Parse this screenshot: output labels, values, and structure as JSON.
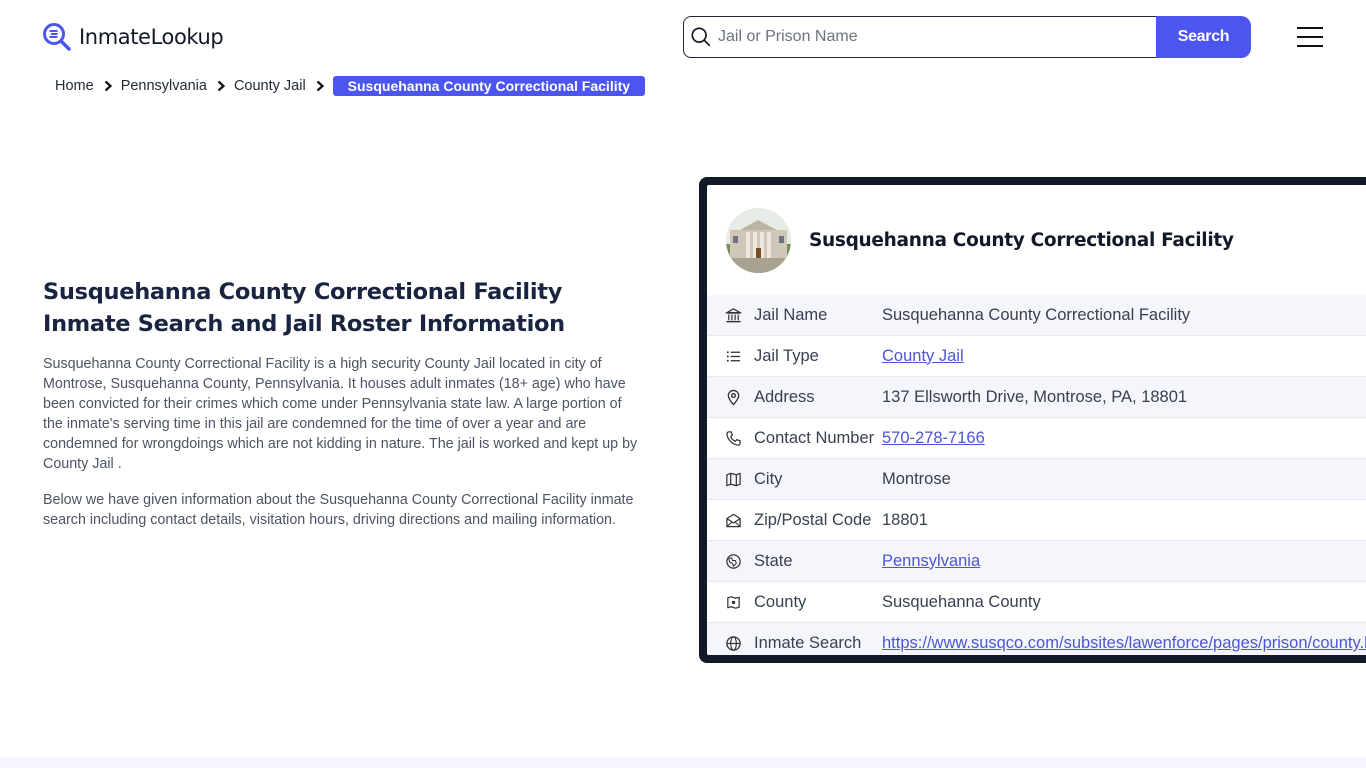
{
  "header": {
    "logo_text": "InmateLookup",
    "search_placeholder": "Jail or Prison Name",
    "search_value": "",
    "search_button": "Search",
    "brand_color": "#4c55f0"
  },
  "breadcrumb": {
    "items": [
      "Home",
      "Pennsylvania",
      "County Jail"
    ],
    "active": "Susquehanna County Correctional Facility"
  },
  "main": {
    "title": "Susquehanna County Correctional Facility Inmate Search and Jail Roster Information",
    "paragraph1": "Susquehanna County Correctional Facility is a high security County Jail located in city of Montrose, Susquehanna County, Pennsylvania. It houses adult inmates (18+ age) who have been convicted for their crimes which come under Pennsylvania state law. A large portion of the inmate's serving time in this jail are condemned for the time of over a year and are condemned for wrongdoings which are not kidding in nature. The jail is worked and kept up by County Jail .",
    "paragraph2": "Below we have given information about the Susquehanna County Correctional Facility inmate search including contact details, visitation hours, driving directions and mailing information."
  },
  "card": {
    "title": "Susquehanna County Correctional Facility",
    "image_alt": "Susquehanna County Correctional Facility building",
    "rows": [
      {
        "icon": "building-columns-icon",
        "label": "Jail Name",
        "value": "Susquehanna County Correctional Facility",
        "link": false
      },
      {
        "icon": "list-icon",
        "label": "Jail Type",
        "value": "County Jail",
        "link": true
      },
      {
        "icon": "map-pin-icon",
        "label": "Address",
        "value": "137 Ellsworth Drive, Montrose, PA, 18801",
        "link": false
      },
      {
        "icon": "phone-icon",
        "label": "Contact Number",
        "value": "570-278-7166",
        "link": true
      },
      {
        "icon": "map-icon",
        "label": "City",
        "value": "Montrose",
        "link": false
      },
      {
        "icon": "mail-open-icon",
        "label": "Zip/Postal Code",
        "value": "18801",
        "link": false
      },
      {
        "icon": "globe-map-icon",
        "label": "State",
        "value": "Pennsylvania",
        "link": true
      },
      {
        "icon": "county-map-icon",
        "label": "County",
        "value": "Susquehanna County",
        "link": false
      },
      {
        "icon": "globe-icon",
        "label": "Inmate Search",
        "value": "https://www.susqco.com/subsites/lawenforce/pages/prison/county.htm",
        "link": true
      }
    ]
  }
}
